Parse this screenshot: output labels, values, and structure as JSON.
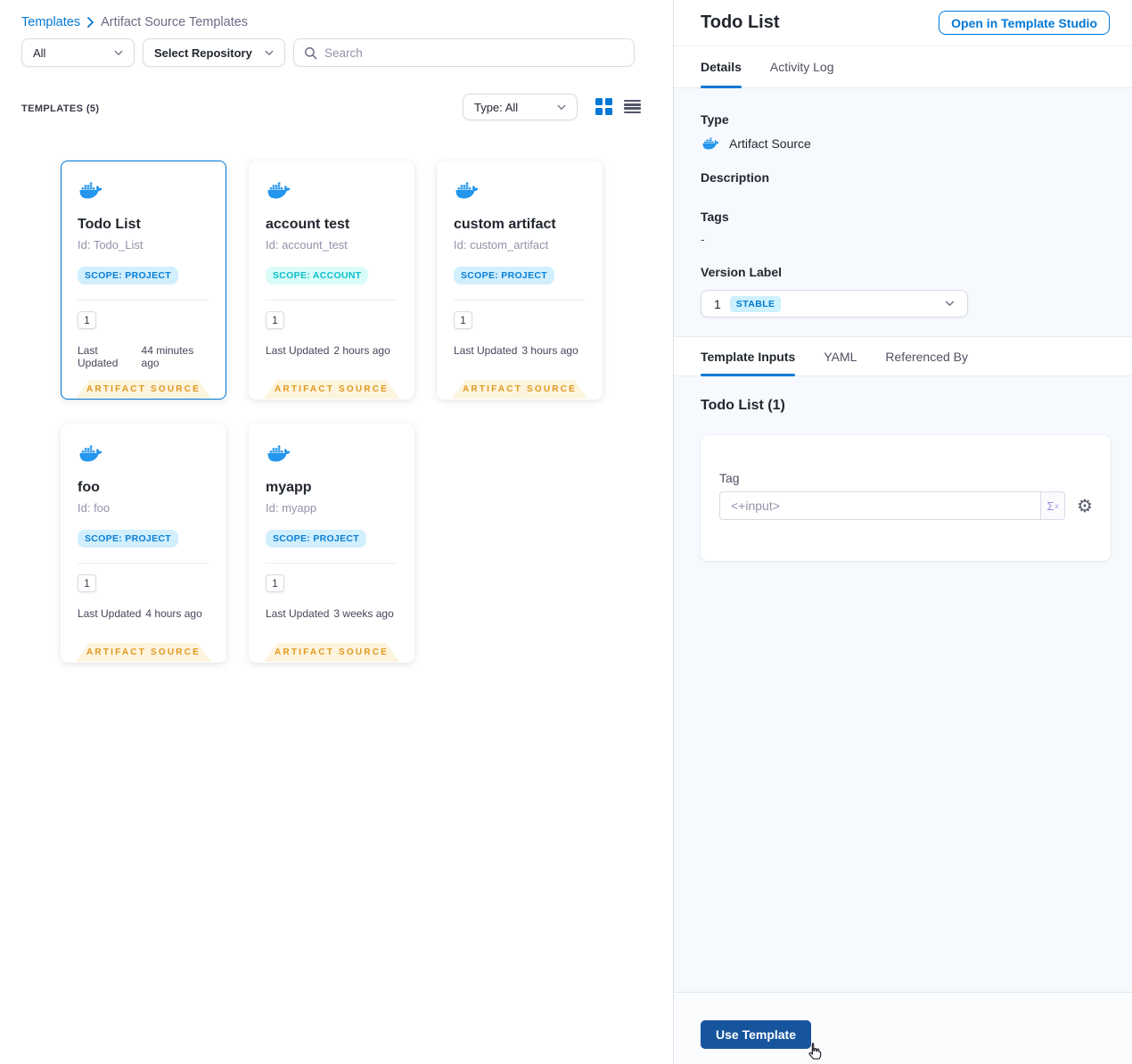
{
  "colors": {
    "primary_blue": "#0278D5",
    "docker_blue": "#2496ED",
    "panel_bg": "#F6F9FD",
    "ribbon_bg": "#FDF4DD",
    "ribbon_text": "#E2981F",
    "scope_project_bg": "#D1EFFD",
    "scope_project_text": "#0A7FD6",
    "scope_account_bg": "#D9FCF8",
    "scope_account_text": "#0AC0CD",
    "stable_badge_bg": "#CDF1FD",
    "use_template_bg": "#17549E"
  },
  "breadcrumb": {
    "templates": "Templates",
    "current": "Artifact Source Templates"
  },
  "filters": {
    "scope": "All",
    "repository": "Select Repository",
    "search_placeholder": "Search"
  },
  "list_header": {
    "count": "TEMPLATES (5)",
    "type_filter": "Type: All"
  },
  "card_common": {
    "last_updated_label": "Last Updated",
    "type_ribbon": "ARTIFACT SOURCE"
  },
  "templates": [
    {
      "name": "Todo List",
      "id": "Id: Todo_List",
      "scope": "SCOPE: PROJECT",
      "scope_type": "project",
      "versions": "1",
      "last_updated": "44 minutes ago",
      "selected": true
    },
    {
      "name": "account test",
      "id": "Id: account_test",
      "scope": "SCOPE: ACCOUNT",
      "scope_type": "account",
      "versions": "1",
      "last_updated": "2 hours ago",
      "selected": false
    },
    {
      "name": "custom artifact",
      "id": "Id: custom_artifact",
      "scope": "SCOPE: PROJECT",
      "scope_type": "project",
      "versions": "1",
      "last_updated": "3 hours ago",
      "selected": false
    },
    {
      "name": "foo",
      "id": "Id: foo",
      "scope": "SCOPE: PROJECT",
      "scope_type": "project",
      "versions": "1",
      "last_updated": "4 hours ago",
      "selected": false
    },
    {
      "name": "myapp",
      "id": "Id: myapp",
      "scope": "SCOPE: PROJECT",
      "scope_type": "project",
      "versions": "1",
      "last_updated": "3 weeks ago",
      "selected": false
    }
  ],
  "panel": {
    "title": "Todo List",
    "open_studio": "Open in Template Studio",
    "tabs": [
      "Details",
      "Activity Log"
    ],
    "type_label": "Type",
    "type_value": "Artifact Source",
    "description_label": "Description",
    "tags_label": "Tags",
    "tags_value": "-",
    "version_label": "Version Label",
    "version_number": "1",
    "version_badge": "STABLE",
    "inner_tabs": [
      "Template Inputs",
      "YAML",
      "Referenced By"
    ],
    "inputs_heading": "Todo List (1)",
    "tag_label": "Tag",
    "tag_value": "<+input>",
    "expression_icon": "Σ",
    "use_template": "Use Template"
  }
}
